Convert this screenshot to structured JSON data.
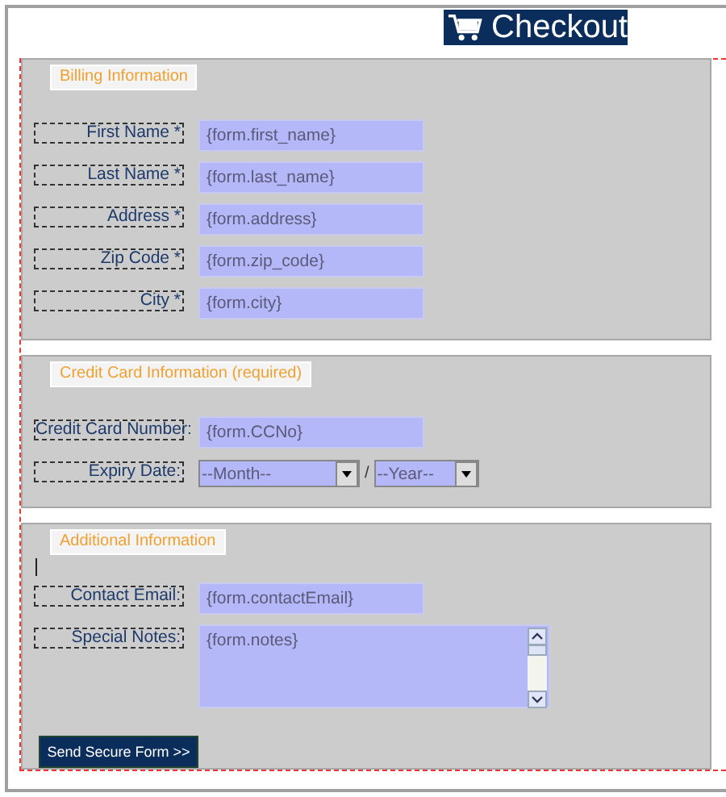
{
  "header": {
    "title": "Checkout"
  },
  "sections": [
    {
      "legend": "Billing Information",
      "cursor": false,
      "fields": [
        {
          "kind": "text",
          "label": "First Name *",
          "value": "{form.first_name}"
        },
        {
          "kind": "text",
          "label": "Last Name *",
          "value": "{form.last_name}"
        },
        {
          "kind": "text",
          "label": "Address *",
          "value": "{form.address}"
        },
        {
          "kind": "text",
          "label": "Zip Code *",
          "value": "{form.zip_code}"
        },
        {
          "kind": "text",
          "label": "City *",
          "value": "{form.city}"
        }
      ]
    },
    {
      "legend": "Credit Card Information (required)",
      "cursor": false,
      "fields": [
        {
          "kind": "text",
          "label": "Credit Card Number:",
          "value": "{form.CCNo}"
        },
        {
          "kind": "expiry",
          "label": "Expiry Date:",
          "month": "--Month--",
          "separator": "/",
          "year": "--Year--"
        }
      ]
    },
    {
      "legend": "Additional Information",
      "cursor": true,
      "fields": [
        {
          "kind": "text",
          "label": "Contact Email:",
          "value": "{form.contactEmail}"
        },
        {
          "kind": "textarea",
          "label": "Special Notes:",
          "value": "{form.notes}"
        }
      ]
    }
  ],
  "submit_button": "Send Secure Form >>"
}
